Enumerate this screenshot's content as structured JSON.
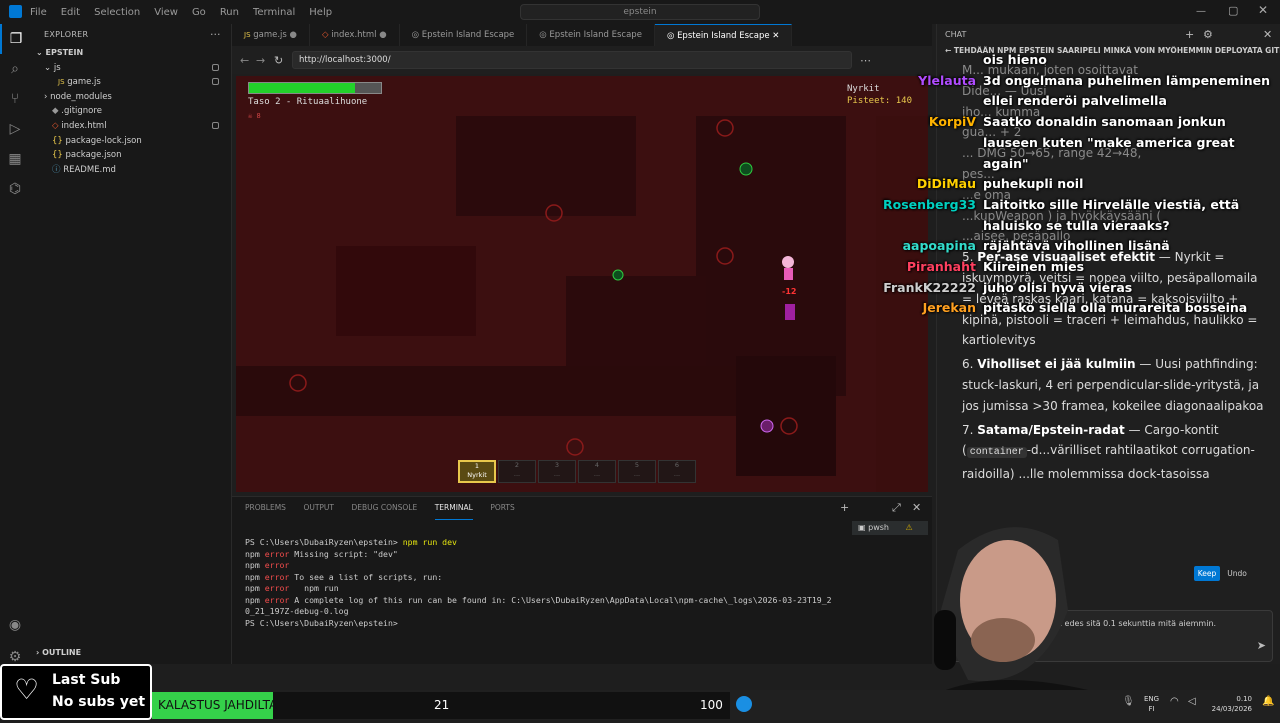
{
  "titlebar": {
    "menu": [
      "File",
      "Edit",
      "Selection",
      "View",
      "Go",
      "Run",
      "Terminal",
      "Help"
    ],
    "search": "epstein"
  },
  "explorer": {
    "header": "EXPLORER",
    "project": "EPSTEIN",
    "items": [
      {
        "label": "js",
        "kind": "folder-open"
      },
      {
        "label": "game.js",
        "kind": "js"
      },
      {
        "label": "node_modules",
        "kind": "folder"
      },
      {
        "label": ".gitignore",
        "kind": "file"
      },
      {
        "label": "index.html",
        "kind": "html"
      },
      {
        "label": "package-lock.json",
        "kind": "json"
      },
      {
        "label": "package.json",
        "kind": "json"
      },
      {
        "label": "README.md",
        "kind": "md"
      }
    ],
    "outline": "OUTLINE"
  },
  "tabs": [
    {
      "label": "game.js",
      "active": false
    },
    {
      "label": "index.html",
      "active": false
    },
    {
      "label": "Epstein Island Escape",
      "active": false
    },
    {
      "label": "Epstein Island Escape",
      "active": false
    },
    {
      "label": "Epstein Island Escape",
      "active": true
    }
  ],
  "browser": {
    "url": "http://localhost:3000/"
  },
  "game": {
    "level": "Taso 2 - Rituaalihuone",
    "kills": "8",
    "weapon_label": "Nyrkit",
    "score_label": "Pisteet: 140",
    "health": 0.8,
    "damage_text": "-12",
    "hotbar": [
      {
        "num": "1",
        "label": "Nyrkit",
        "active": true
      },
      {
        "num": "2",
        "label": "...",
        "active": false
      },
      {
        "num": "3",
        "label": "...",
        "active": false
      },
      {
        "num": "4",
        "label": "...",
        "active": false
      },
      {
        "num": "5",
        "label": "...",
        "active": false
      },
      {
        "num": "6",
        "label": "...",
        "active": false
      }
    ]
  },
  "panel": {
    "tabs": [
      "PROBLEMS",
      "OUTPUT",
      "DEBUG CONSOLE",
      "TERMINAL",
      "PORTS"
    ],
    "active_tab": "TERMINAL",
    "shell": "pwsh",
    "lines": [
      {
        "prefix": "PS C:\\Users\\DubaiRyzen\\epstein> ",
        "cmd": "npm run dev",
        "type": "prompt"
      },
      {
        "prefix": "npm ",
        "kw": "error",
        "rest": " Missing script: \"dev\"",
        "type": "err"
      },
      {
        "prefix": "npm ",
        "kw": "error",
        "rest": "",
        "type": "err"
      },
      {
        "prefix": "npm ",
        "kw": "error",
        "rest": " To see a list of scripts, run:",
        "type": "err"
      },
      {
        "prefix": "npm ",
        "kw": "error",
        "rest": "   npm run",
        "type": "err"
      },
      {
        "prefix": "npm ",
        "kw": "error",
        "rest": " A complete log of this run can be found in: C:\\Users\\DubaiRyzen\\AppData\\Local\\npm-cache\\_logs\\2026-03-23T19_2",
        "type": "err"
      },
      {
        "prefix": "",
        "kw": "",
        "rest": "0_21_197Z-debug-0.log",
        "type": "plain"
      },
      {
        "prefix": "PS C:\\Users\\DubaiRyzen\\epstein> ",
        "cmd": "",
        "type": "prompt"
      }
    ]
  },
  "chat": {
    "header": "CHAT",
    "session_title": "TEHDÄÄN NPM EPSTEIN SAARIPELI MINKÄ VOIN MYÖHEMMIN DEPLOYATA GITH...",
    "ai_lines": [
      "M... mukaan, joten osoittavat",
      "Dide... — Uusi",
      "iho... kumma",
      "gua... + 2",
      "... DMG 50→65, range 42→48,",
      "pes...",
      "...e oma",
      "...kupWeapon ) ja hyökkäysääni (",
      "...aisee, pesäpallo"
    ],
    "item5_title": "Per-ase visuaaliset efektit",
    "item5_text": " — Nyrkit = iskuympyrä, veitsi = nopea viilto, pesäpallomaila = leveä raskas kaari, katana = kaksoisviilto + kipinä, pistooli = traceri + leimahdus, haulikko = kartiolevitys",
    "item6_title": "Viholliset ei jää kulmiin",
    "item6_text": " — Uusi pathfinding: stuck-laskuri, 4 eri perpendicular-slide-yritystä, ja jos jumissa >30 framea, kokeilee diagonaalipakoa",
    "item7_title": "Satama/Epstein-radat",
    "item7_code": "container",
    "item7_text_a": " — Cargo-kontit (",
    "item7_text_b": "-d...värilliset rahtilaatikot corrugation-raidoilla)",
    "item7_text_c": "...lle molemmissa dock-tasoissa",
    "keep": "Keep",
    "undo": "Undo",
    "input_text": "...ä nyt edes sitä 0.1 sekunttia mitä aiemmin."
  },
  "stream_chat": [
    {
      "user": "",
      "color": "#ffffff",
      "msg": "ois hieno"
    },
    {
      "user": "Ylelauta",
      "color": "#b04cff",
      "msg": "3d ongelmana puhelimen lämpeneminen"
    },
    {
      "user": "",
      "color": "#ffffff",
      "msg": "ellei renderöi palvelimella"
    },
    {
      "user": "KorpiV",
      "color": "#ffb300",
      "msg": "Saatko donaldin sanomaan jonkun"
    },
    {
      "user": "",
      "color": "#ffffff",
      "msg": "lauseen kuten \"make america great"
    },
    {
      "user": "",
      "color": "#ffffff",
      "msg": "again\""
    },
    {
      "user": "DiDiMau",
      "color": "#ffd000",
      "msg": "puhekupli noil"
    },
    {
      "user": "Rosenberg33",
      "color": "#00d0c0",
      "msg": "Laitoitko sille Hirvelälle viestiä, että"
    },
    {
      "user": "",
      "color": "#ffffff",
      "msg": "haluisko se tulla vieraaks?"
    },
    {
      "user": "aapoapina",
      "color": "#33ddcc",
      "msg": "räjähtävä vihollinen lisänä"
    },
    {
      "user": "Piranhaht",
      "color": "#ff4060",
      "msg": "Kiireinen mies"
    },
    {
      "user": "FrankK22222",
      "color": "#cfcfcf",
      "msg": "juho olisi hyvä vieras"
    },
    {
      "user": "Jerekan",
      "color": "#ffa020",
      "msg": "pitäskö siellä olla murareita bosseina"
    }
  ],
  "overlay": {
    "last_sub_title": "Last Sub",
    "last_sub_value": "No subs yet",
    "fish_label": "KALASTUS JAHDILTA",
    "fish_current": "21",
    "fish_max": "100",
    "fish_progress": 0.21
  },
  "taskbar": {
    "lang": "ENG",
    "region": "FI",
    "time": "0.10",
    "date": "24/03/2026"
  }
}
